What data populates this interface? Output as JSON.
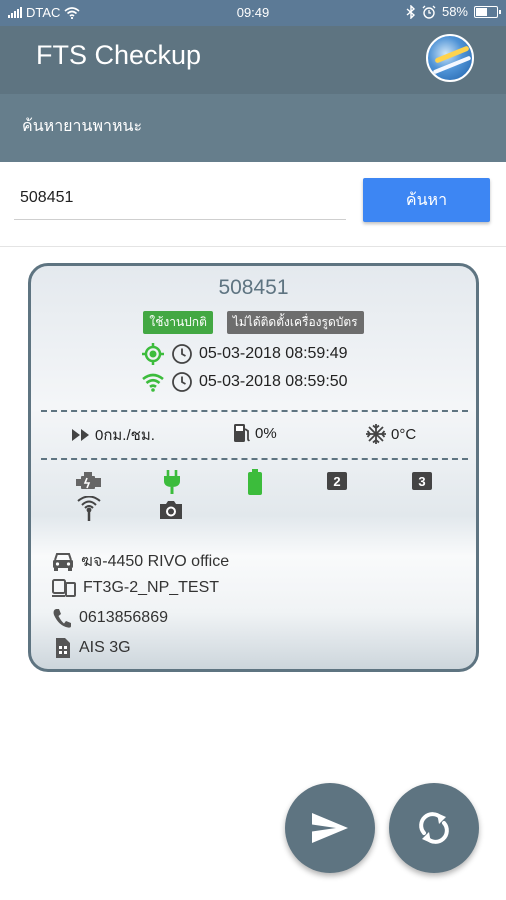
{
  "status_bar": {
    "carrier": "DTAC",
    "time": "09:49",
    "battery": "58%",
    "battery_level": 0.58
  },
  "app": {
    "title": "FTS Checkup"
  },
  "search": {
    "label": "ค้นหายานพาหนะ",
    "value": "508451",
    "button_label": "ค้นหา"
  },
  "vehicle": {
    "plate": "508451",
    "badge_status": "ใช้งานปกติ",
    "badge_card_reader": "ไม่ได้ติดตั้งเครื่องรูดบัตร",
    "gps_time": "05-03-2018 08:59:49",
    "gprs_time": "05-03-2018 08:59:50",
    "speed": "0กม./ชม.",
    "fuel": "0%",
    "temperature": "0°C",
    "box_2": "2",
    "box_3": "3",
    "name": "ฆจ-4450 RIVO office",
    "device": "FT3G-2_NP_TEST",
    "phone": "0613856869",
    "sim": "AIS 3G"
  },
  "colors": {
    "status_bar": "#5c7a96",
    "app_bar": "#5e7481",
    "search_label_bar": "#667e8c",
    "search_button": "#3d86f3",
    "ok_green": "#3cbc3c",
    "badge_gray": "#6d6d6d",
    "fab": "#5e7481"
  },
  "icons": {
    "gps": "gps-target-icon",
    "gprs": "wifi-icon",
    "clock": "clock-icon",
    "speed": "fast-forward-icon",
    "fuel": "fuel-pump-icon",
    "temperature": "snowflake-icon",
    "engine": "engine-icon",
    "power": "plug-icon",
    "battery": "battery-icon",
    "antenna": "antenna-icon",
    "camera": "camera-icon",
    "car": "car-icon",
    "device": "device-icon",
    "phone": "phone-icon",
    "sim": "sim-card-icon",
    "send": "send-icon",
    "refresh": "refresh-icon"
  }
}
